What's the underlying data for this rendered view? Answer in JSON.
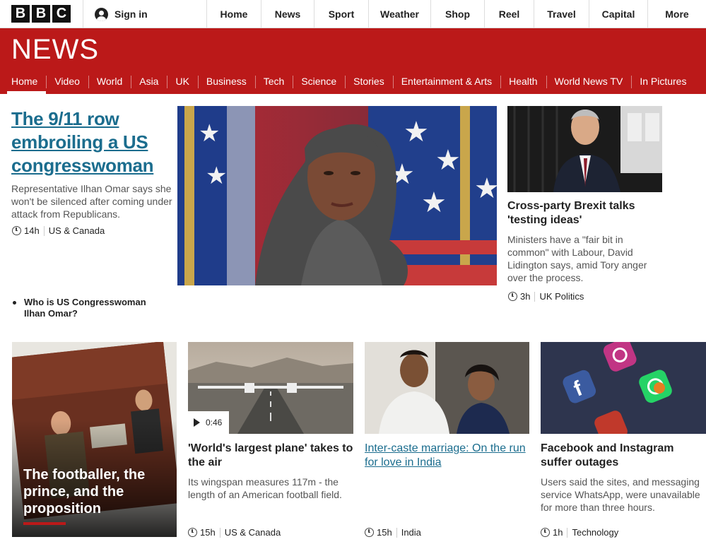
{
  "topbar": {
    "logo": [
      "B",
      "B",
      "C"
    ],
    "signin": "Sign in",
    "nav": [
      "Home",
      "News",
      "Sport",
      "Weather",
      "Shop",
      "Reel",
      "Travel",
      "Capital",
      "More"
    ]
  },
  "section": {
    "title": "NEWS",
    "nav": [
      "Home",
      "Video",
      "World",
      "Asia",
      "UK",
      "Business",
      "Tech",
      "Science",
      "Stories",
      "Entertainment & Arts",
      "Health",
      "World News TV",
      "In Pictures"
    ],
    "active": "Home"
  },
  "lead": {
    "headline": "The 9/11 row embroiling a US congresswoman",
    "summary": "Representative Ilhan Omar says she won't be silenced after coming under attack from Republicans.",
    "time": "14h",
    "tag": "US & Canada",
    "related": "Who is US Congresswoman Ilhan Omar?"
  },
  "secondary": {
    "headline": "Cross-party Brexit talks 'testing ideas'",
    "summary": "Ministers have a \"fair bit in common\" with Labour, David Lidington says, amid Tory anger over the process.",
    "time": "3h",
    "tag": "UK Politics"
  },
  "cards": [
    {
      "headline": "The footballer, the prince, and the proposition"
    },
    {
      "headline": "'World's largest plane' takes to the air",
      "summary": "Its wingspan measures 117m - the length of an American football field.",
      "time": "15h",
      "tag": "US & Canada",
      "duration": "0:46"
    },
    {
      "headline": "Inter-caste marriage: On the run for love in India",
      "time": "15h",
      "tag": "India"
    },
    {
      "headline": "Facebook and Instagram suffer outages",
      "summary": "Users said the sites, and messaging service WhatsApp, were unavailable for more than three hours.",
      "time": "1h",
      "tag": "Technology"
    }
  ],
  "colors": {
    "brand_red": "#bb1919",
    "link_blue": "#1b6d8e"
  }
}
